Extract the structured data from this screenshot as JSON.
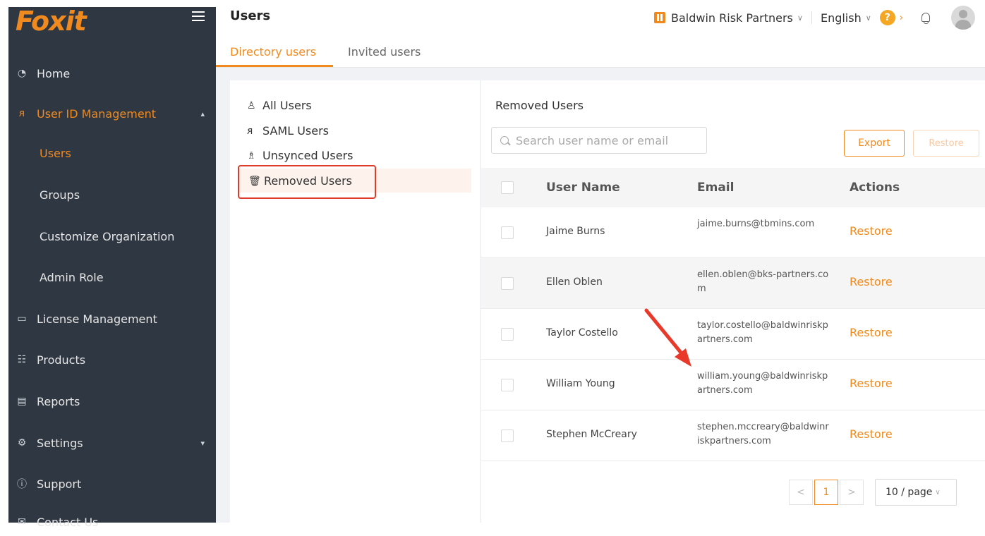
{
  "sidebar": {
    "logo": "Foxit",
    "items": [
      {
        "label": "Home",
        "icon": "dashboard-icon"
      },
      {
        "label": "User ID Management",
        "icon": "users-icon"
      },
      {
        "label": "License Management",
        "icon": "license-icon"
      },
      {
        "label": "Products",
        "icon": "products-icon"
      },
      {
        "label": "Reports",
        "icon": "reports-icon"
      },
      {
        "label": "Settings",
        "icon": "settings-icon"
      },
      {
        "label": "Support",
        "icon": "help-circle-icon"
      },
      {
        "label": "Contact Us",
        "icon": "contact-icon"
      }
    ],
    "subitems": [
      {
        "label": "Users"
      },
      {
        "label": "Groups"
      },
      {
        "label": "Customize Organization"
      },
      {
        "label": "Admin Role"
      }
    ]
  },
  "header": {
    "title": "Users",
    "org": "Baldwin Risk Partners",
    "language": "English",
    "help": "?"
  },
  "tabs": [
    {
      "label": "Directory users"
    },
    {
      "label": "Invited users"
    }
  ],
  "filters": [
    {
      "label": "All Users",
      "icon": "user-icon"
    },
    {
      "label": "SAML Users",
      "icon": "users-icon"
    },
    {
      "label": "Unsynced Users",
      "icon": "unsynced-users-icon"
    },
    {
      "label": "Removed Users",
      "icon": "trash-icon"
    }
  ],
  "main": {
    "title": "Removed Users",
    "search_placeholder": "Search user name or email",
    "export_label": "Export",
    "restore_label": "Restore",
    "columns": {
      "name": "User Name",
      "email": "Email",
      "actions": "Actions"
    },
    "rows": [
      {
        "name": "Jaime Burns",
        "email": "jaime.burns@tbmins.com",
        "action": "Restore"
      },
      {
        "name": "Ellen Oblen",
        "email": "ellen.oblen@bks-partners.com",
        "action": "Restore"
      },
      {
        "name": "Taylor Costello",
        "email": "taylor.costello@baldwinriskpartners.com",
        "action": "Restore"
      },
      {
        "name": "William Young",
        "email": "william.young@baldwinriskpartners.com",
        "action": "Restore"
      },
      {
        "name": "Stephen McCreary",
        "email": "stephen.mccreary@baldwinriskpartners.com",
        "action": "Restore"
      }
    ]
  },
  "pagination": {
    "prev": "<",
    "current": "1",
    "next": ">",
    "page_size": "10 / page"
  },
  "colors": {
    "accent": "#f08a1f",
    "sidebar_bg": "#2f3742",
    "highlight_box": "#e03a2a",
    "arrow": "#e8392a"
  }
}
